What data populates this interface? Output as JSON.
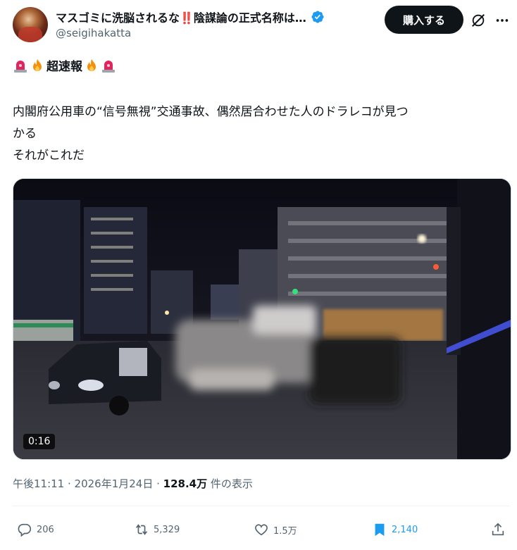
{
  "author": {
    "display_name": "マスゴミに洗脳されるな‼️陰謀論の正式名称は…",
    "handle": "@seigihakatta",
    "verified": true
  },
  "header": {
    "buy_label": "購入する"
  },
  "tweet": {
    "headline": "超速報",
    "lines": [
      "内閣府公用車の“信号無視”交通事故、偶然居合わせた人のドラレコが見つ",
      "かる",
      "それがこれだ"
    ]
  },
  "media": {
    "duration": "0:16"
  },
  "meta": {
    "time": "午後11:11",
    "separator1": " · ",
    "date": "2026年1月24日",
    "separator2": " · ",
    "views_count": "128.4万",
    "views_label": " 件の表示"
  },
  "actions": {
    "replies": "206",
    "reposts": "5,329",
    "likes": "1.5万",
    "bookmarks": "2,140"
  },
  "colors": {
    "accent": "#1d9bf0",
    "text": "#0f1419",
    "muted": "#536471"
  }
}
